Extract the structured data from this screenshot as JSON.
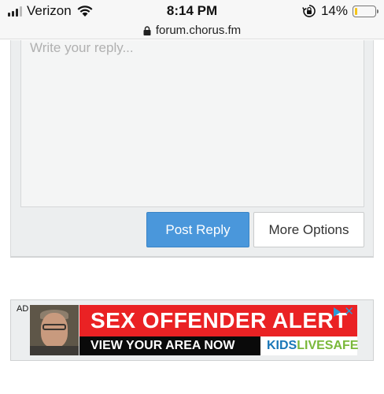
{
  "status_bar": {
    "carrier": "Verizon",
    "time": "8:14 PM",
    "battery_percent": "14%",
    "battery_level": 0.14
  },
  "browser": {
    "url": "forum.chorus.fm"
  },
  "reply": {
    "placeholder": "Write your reply...",
    "post_button": "Post Reply",
    "more_options_button": "More Options"
  },
  "ad": {
    "label": "AD",
    "headline": "SEX OFFENDER ALERT",
    "subline": "VIEW YOUR AREA NOW",
    "brand_part1": "KIDS",
    "brand_part2": "LIVESAFE",
    "colors": {
      "red": "#ea2224",
      "brand_blue": "#1a77b8",
      "brand_green": "#7ab83a"
    }
  },
  "colors": {
    "accent": "#4a97db"
  }
}
